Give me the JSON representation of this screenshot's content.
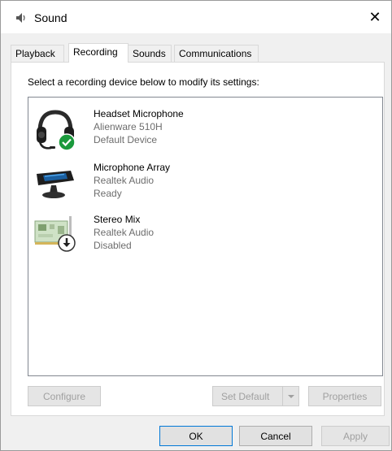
{
  "window": {
    "title": "Sound",
    "close_glyph": "✕"
  },
  "tabs": [
    {
      "label": "Playback",
      "active": false
    },
    {
      "label": "Recording",
      "active": true
    },
    {
      "label": "Sounds",
      "active": false
    },
    {
      "label": "Communications",
      "active": false
    }
  ],
  "recording": {
    "instruction": "Select a recording device below to modify its settings:",
    "devices": [
      {
        "name": "Headset Microphone",
        "driver": "Alienware 510H",
        "status": "Default Device",
        "icon": "headset-icon",
        "badge": "checkmark-badge-icon",
        "badge_color": "#1a9a3c"
      },
      {
        "name": "Microphone Array",
        "driver": "Realtek Audio",
        "status": "Ready",
        "icon": "microphone-array-icon"
      },
      {
        "name": "Stereo Mix",
        "driver": "Realtek Audio",
        "status": "Disabled",
        "icon": "sound-card-icon",
        "badge": "disabled-arrow-badge-icon"
      }
    ],
    "buttons": {
      "configure": "Configure",
      "set_default": "Set Default",
      "properties": "Properties"
    }
  },
  "footer": {
    "ok": "OK",
    "cancel": "Cancel",
    "apply": "Apply"
  },
  "colors": {
    "focus_border": "#0078d7",
    "disabled_text": "#a0a0a0",
    "secondary_text": "#6d6d6d"
  }
}
